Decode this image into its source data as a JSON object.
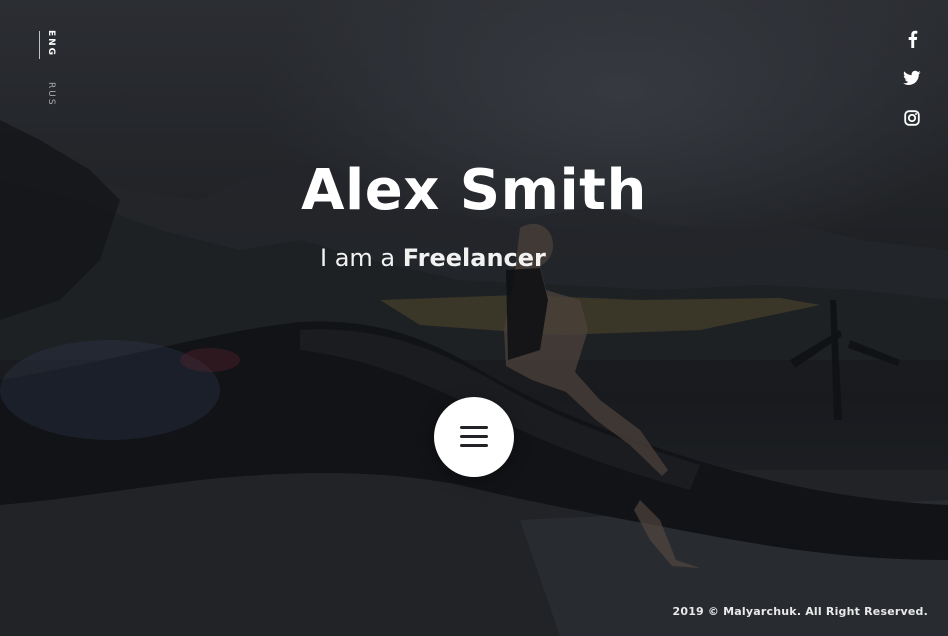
{
  "languages": {
    "active": "ENG",
    "inactive": "RUS"
  },
  "social": [
    {
      "name": "facebook",
      "icon": "facebook-icon"
    },
    {
      "name": "twitter",
      "icon": "twitter-icon"
    },
    {
      "name": "instagram",
      "icon": "instagram-icon"
    }
  ],
  "hero": {
    "name": "Alex Smith",
    "tagline_prefix": "I am a ",
    "tagline_highlight": "Freelancer"
  },
  "menu": {
    "icon": "hamburger-menu-icon"
  },
  "footer": {
    "copyright": "2019 © Malyarchuk. All Right Reserved."
  },
  "colors": {
    "background": "#1c1d21",
    "text": "#ffffff",
    "menu_button": "#ffffff",
    "menu_bars": "#222327"
  }
}
